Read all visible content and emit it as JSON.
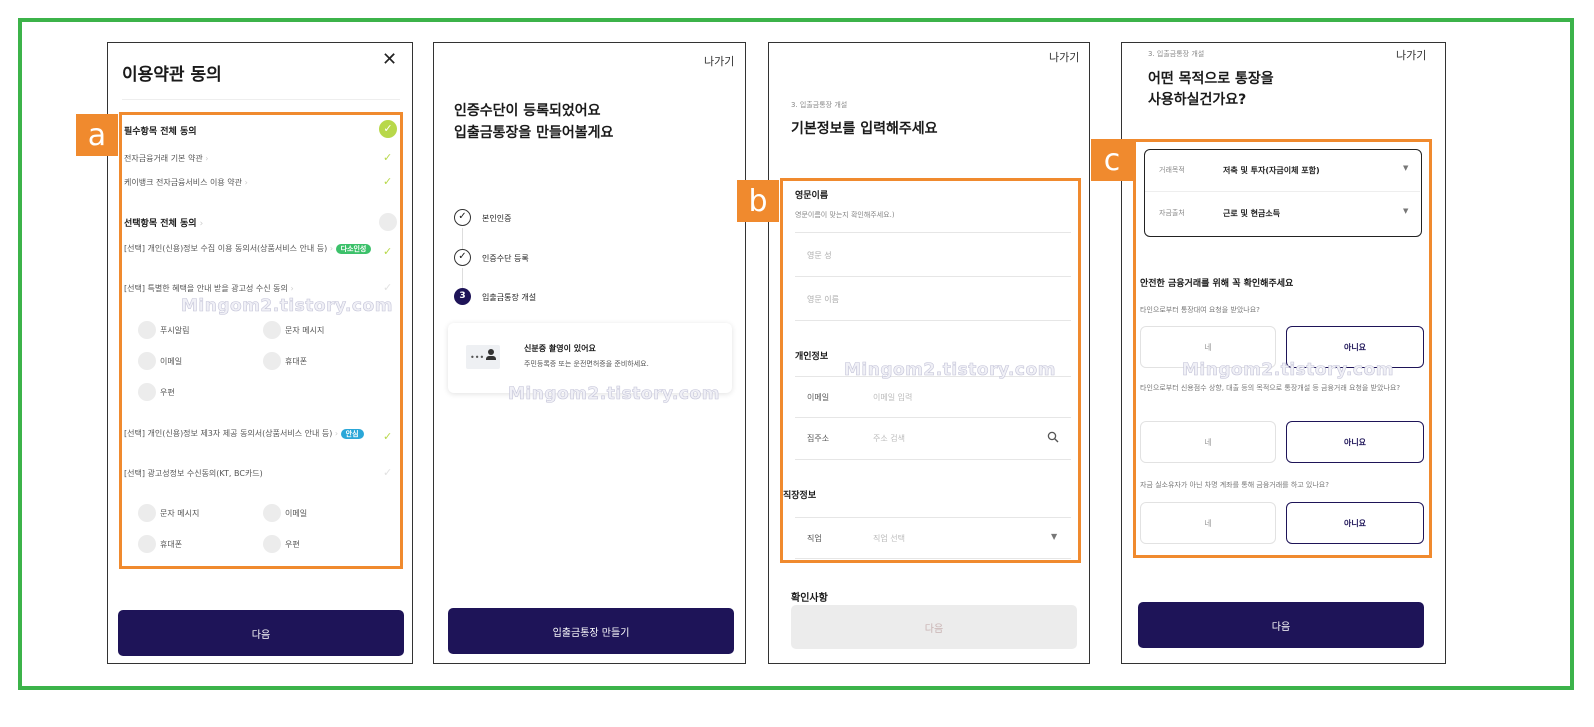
{
  "colors": {
    "frame": "#3cb34a",
    "highlight": "#f08a2e",
    "primary": "#1e1458",
    "check": "#b8d84a",
    "chip_green": "#3cc16a",
    "chip_blue": "#2aa7d8"
  },
  "watermark": "Mingom2.tistory.com",
  "labels": {
    "a": "a",
    "b": "b",
    "c": "c"
  },
  "screen1": {
    "title": "이용약관 동의",
    "close_icon": "close-icon",
    "required_all": "필수항목 전체 동의",
    "required_items": [
      "전자금융거래 기본 약관",
      "케이뱅크 전자금융서비스 이용 약관"
    ],
    "optional_all": "선택항목 전체 동의",
    "opt1_text": "[선택] 개인(신용)정보 수집 이용 동의서(상품서비스 안내 등)",
    "opt1_chip": "다소인성",
    "opt2_text": "[선택] 특별한 혜택을 안내 받을 광고성 수신 동의",
    "opt2_channels": [
      "푸시알림",
      "문자 메시지",
      "이메일",
      "휴대폰",
      "우편"
    ],
    "opt3_text": "[선택] 개인(신용)정보 제3자 제공 동의서(상품서비스 안내 등)",
    "opt3_chip": "안심",
    "opt4_text": "[선택] 광고성정보 수신동의(KT, BC카드)",
    "opt4_channels": [
      "문자 메시지",
      "이메일",
      "휴대폰",
      "우편"
    ],
    "next_button": "다음"
  },
  "screen2": {
    "exit": "나가기",
    "title_line1": "인증수단이 등록되었어요",
    "title_line2": "입출금통장을 만들어볼게요",
    "steps": [
      "본인인증",
      "인증수단 등록",
      "입출금통장 개설"
    ],
    "step3_number": "3",
    "card_title": "신분증 촬영이 있어요",
    "card_desc": "주민등록증 또는 운전면허증을 준비하세요.",
    "button": "입출금통장 만들기"
  },
  "screen3": {
    "exit": "나가기",
    "step_caption": "3. 입출금통장 개설",
    "title": "기본정보를 입력해주세요",
    "english_name_section": "영문이름",
    "english_name_hint": "영문이름이 맞는지 확인해주세요.)",
    "last_name_placeholder": "영문 성",
    "first_name_placeholder": "영문 이름",
    "personal_section": "개인정보",
    "email_label": "이메일",
    "email_placeholder": "이메일 입력",
    "address_label": "집주소",
    "address_placeholder": "주소 검색",
    "job_section": "직장정보",
    "job_label": "직업",
    "job_placeholder": "직업 선택",
    "confirm_section": "확인사항",
    "next_button": "다음"
  },
  "screen4": {
    "step_caption": "3. 입출금통장 개설",
    "exit": "나가기",
    "title_line1": "어떤 목적으로 통장을",
    "title_line2": "사용하실건가요?",
    "purpose_label": "거래목적",
    "purpose_value": "저축 및 투자(자금이체 포함)",
    "source_label": "자금출처",
    "source_value": "근로 및 현금소득",
    "safety_heading": "안전한 금융거래를 위해 꼭 확인해주세요",
    "q1": "타인으로부터 통장대여 요청을 받았나요?",
    "q2": "타인으로부터 신용점수 상향, 대출 등의 목적으로 통장개설 등 금융거래 요청을 받았나요?",
    "q3": "자금 실소유자가 아닌 차명 계좌를 통해 금융거래를 하고 있나요?",
    "yes": "네",
    "no": "아니요",
    "next_button": "다음"
  }
}
